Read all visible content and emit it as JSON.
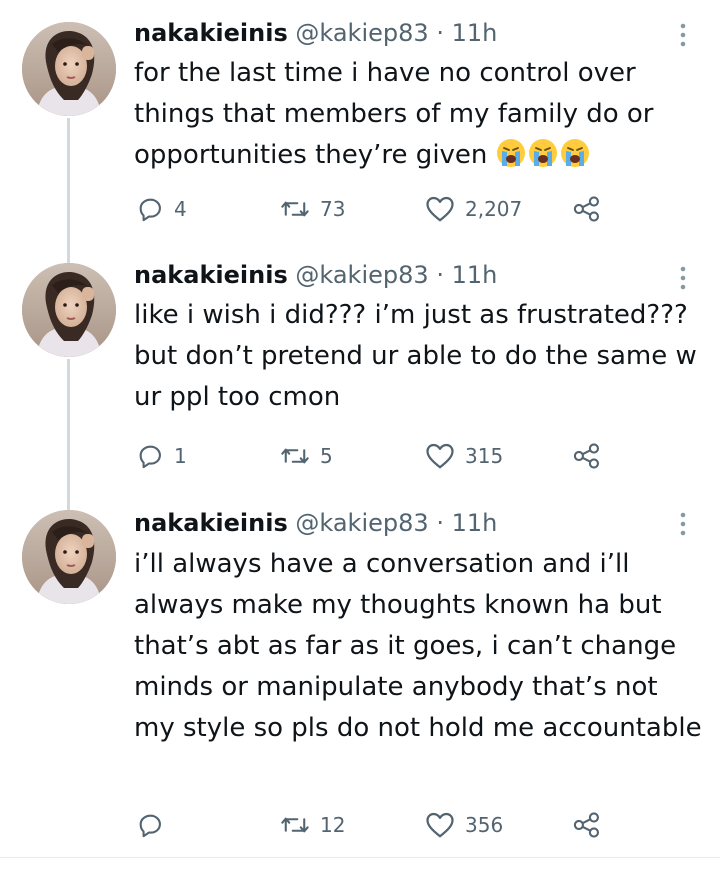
{
  "tweets": [
    {
      "name": "nakakieinis",
      "handle": "@kakiep83",
      "dot": "·",
      "time": "11h",
      "text": "for the last time i have no control over things that members of my family do or opportunities they’re given",
      "emojis": [
        "loudly-crying-face",
        "loudly-crying-face",
        "loudly-crying-face"
      ],
      "replies": "4",
      "retweets": "73",
      "likes": "2,207"
    },
    {
      "name": "nakakieinis",
      "handle": "@kakiep83",
      "dot": "·",
      "time": "11h",
      "text": "like i wish i did??? i’m just as frustrated??? but don’t pretend ur able to do the same w ur ppl too cmon",
      "replies": "1",
      "retweets": "5",
      "likes": "315"
    },
    {
      "name": "nakakieinis",
      "handle": "@kakiep83",
      "dot": "·",
      "time": "11h",
      "text": "i’ll always have a conversation and i’ll always make my thoughts known ha but that’s abt as far as it goes, i can’t change minds or manipulate anybody that’s not my style so pls do not hold me accountable",
      "replies": "",
      "retweets": "12",
      "likes": "356"
    }
  ],
  "colors": {
    "text": "#0f1419",
    "secondary": "#536471",
    "thread_line": "#cfd9de"
  }
}
